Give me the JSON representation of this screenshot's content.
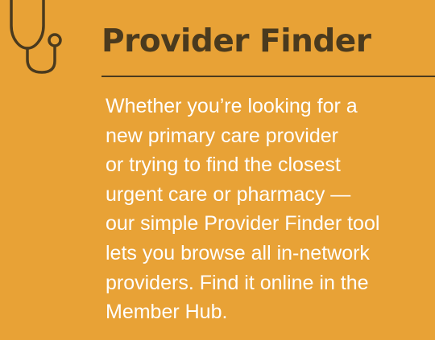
{
  "card": {
    "icon": "stethoscope-icon",
    "title": "Provider Finder",
    "body_lines": [
      "Whether you’re looking for a",
      "new primary care provider",
      "or trying to find the closest",
      "urgent care or pharmacy —",
      "our simple Provider Finder tool",
      "lets you browse all in-network",
      "providers. Find it online in the",
      "Member Hub."
    ]
  },
  "colors": {
    "background": "#E8A236",
    "title": "#4A3A1E",
    "divider": "#4A3A1E",
    "body_text": "#FFFFFF",
    "icon_stroke": "#4A3A1E"
  }
}
